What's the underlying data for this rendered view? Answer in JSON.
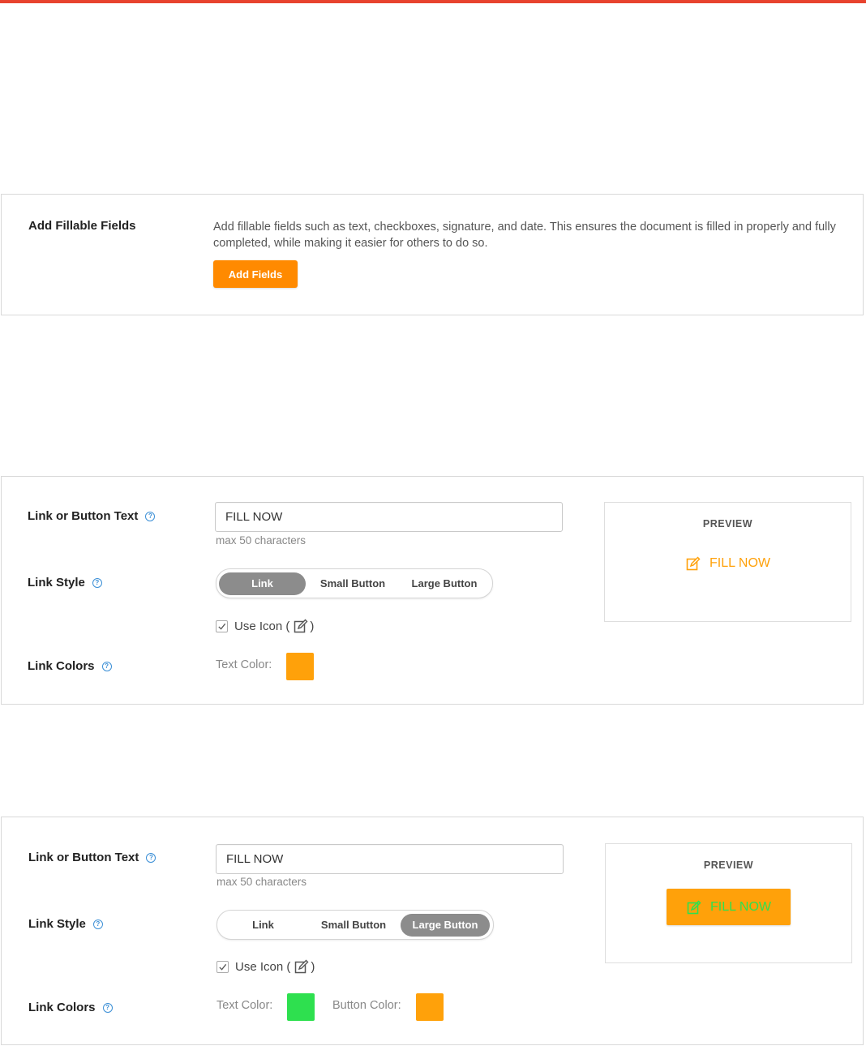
{
  "fillable_fields": {
    "heading": "Add Fillable Fields",
    "description": "Add fillable fields such as text, checkboxes, signature, and date. This ensures the document is filled in properly and fully completed, while making it easier for others to do so.",
    "button_label": "Add Fields"
  },
  "link_panel": {
    "text_label": "Link or Button Text",
    "text_value": "FILL NOW",
    "hint": "max 50 characters",
    "style_label": "Link Style",
    "style_options": [
      "Link",
      "Small Button",
      "Large Button"
    ],
    "selected_style": "Link",
    "use_icon_label": "Use Icon (",
    "use_icon_suffix": ")",
    "use_icon_checked": true,
    "colors_label": "Link Colors",
    "text_color_label": "Text Color:",
    "text_color": "#ffa10a",
    "preview_title": "PREVIEW",
    "preview_text": "FILL NOW"
  },
  "button_panel": {
    "text_label": "Link or Button Text",
    "text_value": "FILL NOW",
    "hint": "max 50 characters",
    "style_label": "Link Style",
    "style_options": [
      "Link",
      "Small Button",
      "Large Button"
    ],
    "selected_style": "Large Button",
    "use_icon_label": "Use Icon (",
    "use_icon_suffix": ")",
    "use_icon_checked": true,
    "colors_label": "Link Colors",
    "text_color_label": "Text Color:",
    "text_color": "#2ee04f",
    "button_color_label": "Button Color:",
    "button_color": "#ffa10a",
    "preview_title": "PREVIEW",
    "preview_text": "FILL NOW"
  },
  "colors": {
    "top_bar": "#e8432e",
    "add_fields_button": "#ff8a00",
    "segment_active": "#8c8c8c",
    "help_icon": "#3b8fd6"
  },
  "icons": {
    "help": "question-circle-icon",
    "edit": "edit-pencil-icon",
    "check": "check-icon"
  }
}
